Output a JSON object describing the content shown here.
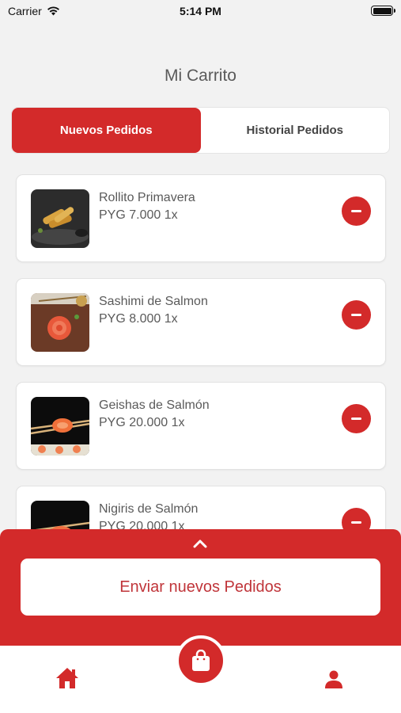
{
  "status_bar": {
    "carrier": "Carrier",
    "time": "5:14 PM"
  },
  "header": {
    "title": "Mi Carrito"
  },
  "tabs": [
    {
      "label": "Nuevos Pedidos",
      "active": true
    },
    {
      "label": "Historial Pedidos",
      "active": false
    }
  ],
  "cart": {
    "items": [
      {
        "name": "Rollito Primavera",
        "price": "PYG 7.000 1x",
        "image": "spring-rolls-photo"
      },
      {
        "name": "Sashimi de Salmon",
        "price": "PYG 8.000 1x",
        "image": "salmon-sashimi-photo"
      },
      {
        "name": "Geishas de Salmón",
        "price": "PYG 20.000 1x",
        "image": "salmon-geisha-photo"
      },
      {
        "name": "Nigiris de Salmón",
        "price": "PYG 20.000 1x",
        "image": "salmon-nigiri-photo"
      }
    ]
  },
  "bottom_sheet": {
    "send_label": "Enviar nuevos Pedidos",
    "expand_icon": "chevron-up-icon"
  },
  "tab_bar": {
    "items": [
      "home-icon",
      "shopping-bag-icon",
      "user-icon"
    ]
  },
  "colors": {
    "accent": "#d32a2a",
    "background": "#f2f2f2",
    "text": "#5a5a5a"
  }
}
